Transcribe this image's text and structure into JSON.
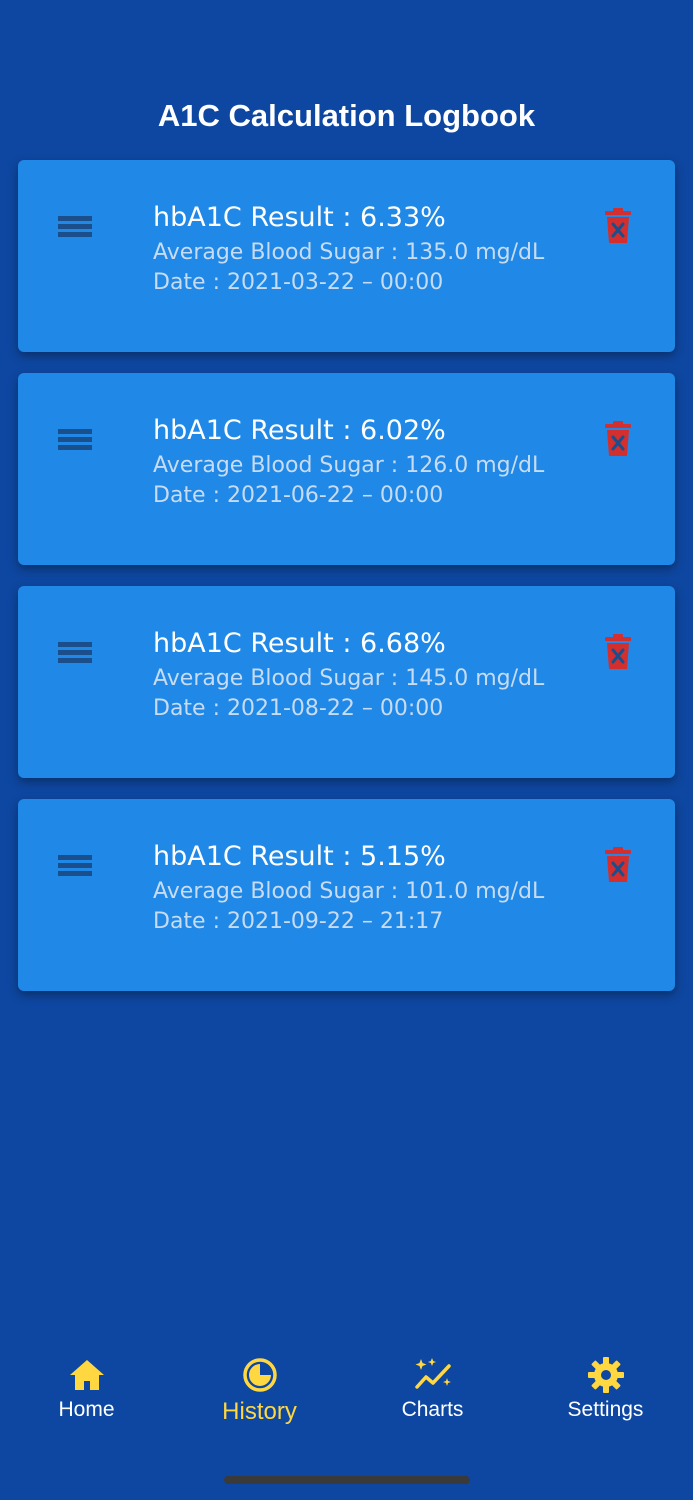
{
  "header": {
    "title": "A1C Calculation Logbook"
  },
  "entries": [
    {
      "result": "hbA1C Result : 6.33%",
      "average": "Average Blood Sugar : 135.0 mg/dL",
      "date": "Date : 2021-03-22 – 00:00"
    },
    {
      "result": "hbA1C Result : 6.02%",
      "average": "Average Blood Sugar : 126.0 mg/dL",
      "date": "Date : 2021-06-22 – 00:00"
    },
    {
      "result": "hbA1C Result : 6.68%",
      "average": "Average Blood Sugar : 145.0 mg/dL",
      "date": "Date : 2021-08-22 – 00:00"
    },
    {
      "result": "hbA1C Result : 5.15%",
      "average": "Average Blood Sugar : 101.0 mg/dL",
      "date": "Date : 2021-09-22 – 21:17"
    }
  ],
  "tabs": [
    {
      "label": "Home",
      "icon": "home-icon"
    },
    {
      "label": "History",
      "icon": "history-icon",
      "active": true
    },
    {
      "label": "Charts",
      "icon": "charts-icon"
    },
    {
      "label": "Settings",
      "icon": "gear-icon"
    }
  ],
  "colors": {
    "background": "#0e47a1",
    "card": "#2088e6",
    "delete": "#d32f2f",
    "active_tab": "#ffd740"
  }
}
